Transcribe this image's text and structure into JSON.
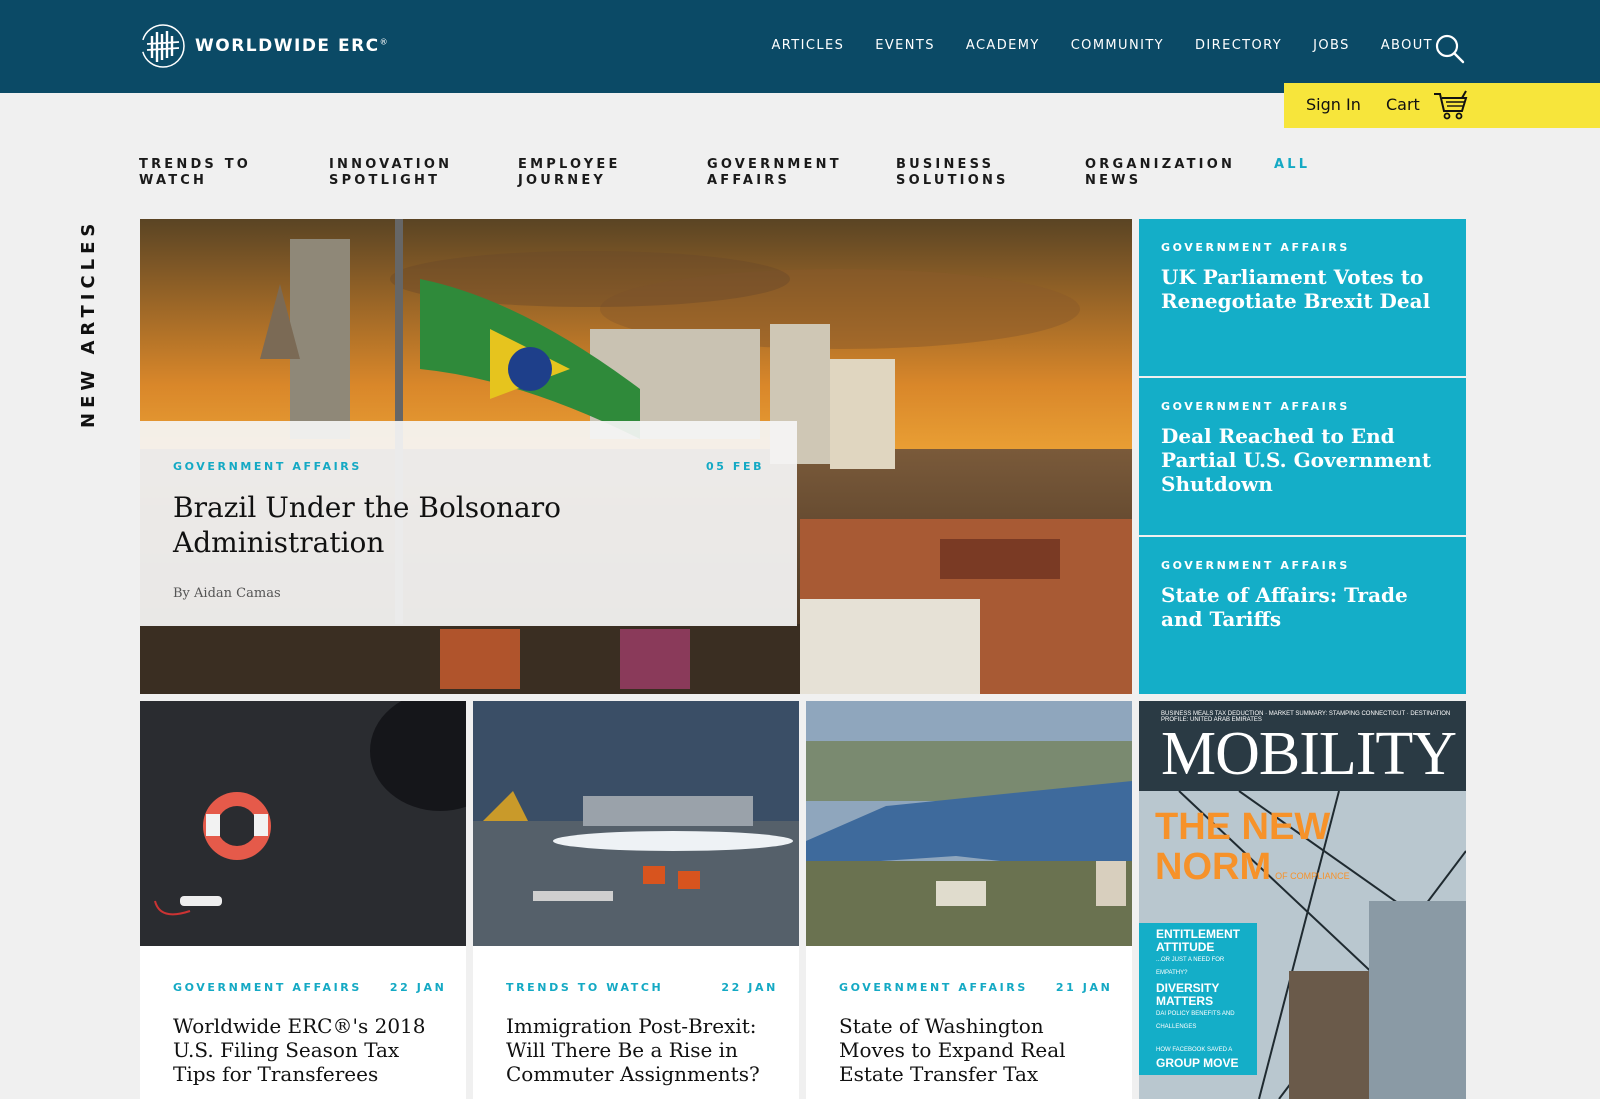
{
  "header": {
    "logo_text": "WORLDWIDE ERC",
    "logo_reg": "®",
    "nav": [
      "ARTICLES",
      "EVENTS",
      "ACADEMY",
      "COMMUNITY",
      "DIRECTORY",
      "JOBS",
      "ABOUT"
    ],
    "sign_in": "Sign In",
    "cart": "Cart"
  },
  "colors": {
    "header_bg": "#0b4a66",
    "account_bar": "#f7e53b",
    "accent": "#14aec8"
  },
  "icons": [
    "logo-mark-icon",
    "search-icon",
    "cart-icon"
  ],
  "subnav": {
    "items": [
      {
        "line1": "TRENDS TO",
        "line2": "WATCH"
      },
      {
        "line1": "INNOVATION",
        "line2": "SPOTLIGHT"
      },
      {
        "line1": "EMPLOYEE",
        "line2": "JOURNEY"
      },
      {
        "line1": "GOVERNMENT",
        "line2": "AFFAIRS"
      },
      {
        "line1": "BUSINESS",
        "line2": "SOLUTIONS"
      },
      {
        "line1": "ORGANIZATION",
        "line2": "NEWS"
      }
    ],
    "all": "ALL"
  },
  "section_label": "NEW ARTICLES",
  "feature": {
    "category": "GOVERNMENT AFFAIRS",
    "date": "05 FEB",
    "title": "Brazil Under the Bolsonaro Administration",
    "by": "By",
    "author": "Aidan Camas"
  },
  "side_articles": [
    {
      "category": "GOVERNMENT AFFAIRS",
      "title": "UK Parliament Votes to Renegotiate Brexit Deal"
    },
    {
      "category": "GOVERNMENT AFFAIRS",
      "title": "Deal Reached to End Partial U.S. Government Shutdown"
    },
    {
      "category": "GOVERNMENT AFFAIRS",
      "title": "State of Affairs: Trade and Tariffs"
    }
  ],
  "tiles": [
    {
      "category": "GOVERNMENT AFFAIRS",
      "date": "22 JAN",
      "title": "Worldwide ERC®'s 2018 U.S. Filing Season Tax Tips for Transferees"
    },
    {
      "category": "TRENDS TO WATCH",
      "date": "22 JAN",
      "title": "Immigration Post-Brexit: Will There Be a Rise in Commuter Assignments?"
    },
    {
      "category": "GOVERNMENT AFFAIRS",
      "date": "21 JAN",
      "title": "State of Washington Moves to Expand Real Estate Transfer Tax"
    }
  ],
  "magazine": {
    "topline": "BUSINESS MEALS TAX DEDUCTION · MARKET SUMMARY: STAMPING CONNECTICUT · DESTINATION PROFILE: UNITED ARAB EMIRATES",
    "title": "MOBILITY",
    "headline1": "THE NEW",
    "headline2": "NORM",
    "headline_sub": "OF COMPLIANCE",
    "box1": "ENTITLEMENT ATTITUDE",
    "box1_sub": "...OR JUST A NEED FOR EMPATHY?",
    "box2": "DIVERSITY MATTERS",
    "box2_sub": "DAI POLICY BENEFITS AND CHALLENGES",
    "box3_sub": "HOW FACEBOOK SAVED A",
    "box3": "GROUP MOVE"
  }
}
